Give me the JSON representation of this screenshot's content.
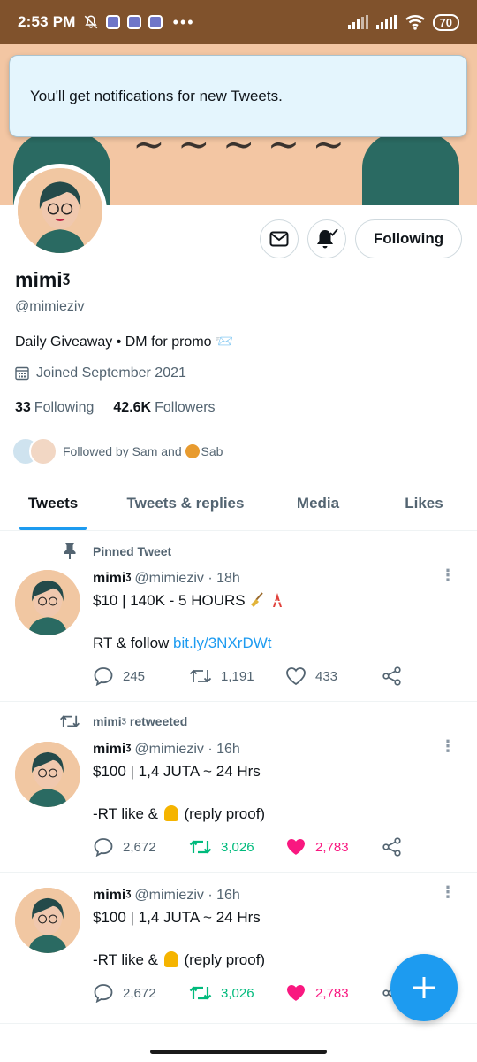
{
  "status_bar": {
    "time": "2:53 PM",
    "battery": "70",
    "more": "•••"
  },
  "toast": {
    "message": "You'll get notifications for new Tweets."
  },
  "profile": {
    "display_name": "mimiᶾ",
    "handle": "@mimieziv",
    "bio": "Daily Giveaway • DM for promo 📨",
    "joined": "Joined September 2021",
    "following_count": "33",
    "following_label": "Following",
    "followers_count": "42.6K",
    "followers_label": "Followers",
    "followed_by_prefix": "Followed by Sam and ",
    "followed_by_last": "Sab",
    "following_button": "Following"
  },
  "tabs": [
    {
      "label": "Tweets",
      "active": true
    },
    {
      "label": "Tweets & replies",
      "active": false
    },
    {
      "label": "Media",
      "active": false
    },
    {
      "label": "Likes",
      "active": false
    }
  ],
  "tweets": [
    {
      "context": "Pinned Tweet",
      "name": "mimiᶾ",
      "meta": "@mimieziv · 18h",
      "line1": "$10 | 140K - 5 HOURS",
      "line2_prefix": "RT & follow ",
      "line2_link": "bit.ly/3NXrDWt",
      "replies": "245",
      "retweets": "1,191",
      "likes": "433"
    },
    {
      "context": "mimiᶾ retweeted",
      "name": "mimiᶾ",
      "meta": "@mimieziv · 16h",
      "line1": "$100 | 1,4 JUTA ~ 24 Hrs",
      "line2_a": "-RT like & ",
      "line2_b": " (reply proof)",
      "replies": "2,672",
      "retweets": "3,026",
      "likes": "2,783"
    },
    {
      "name": "mimiᶾ",
      "meta": "@mimieziv · 16h",
      "line1": "$100 | 1,4 JUTA ~ 24 Hrs",
      "line2_a": "-RT like & ",
      "line2_b": " (reply proof)",
      "replies": "2,672",
      "retweets": "3,026",
      "likes": "2,783"
    }
  ],
  "colors": {
    "status_bar": "#80522c",
    "banner": "#f3c6a3",
    "accent": "#1d9bf0",
    "retweet_active": "#00ba7c",
    "like_active": "#f91880"
  }
}
